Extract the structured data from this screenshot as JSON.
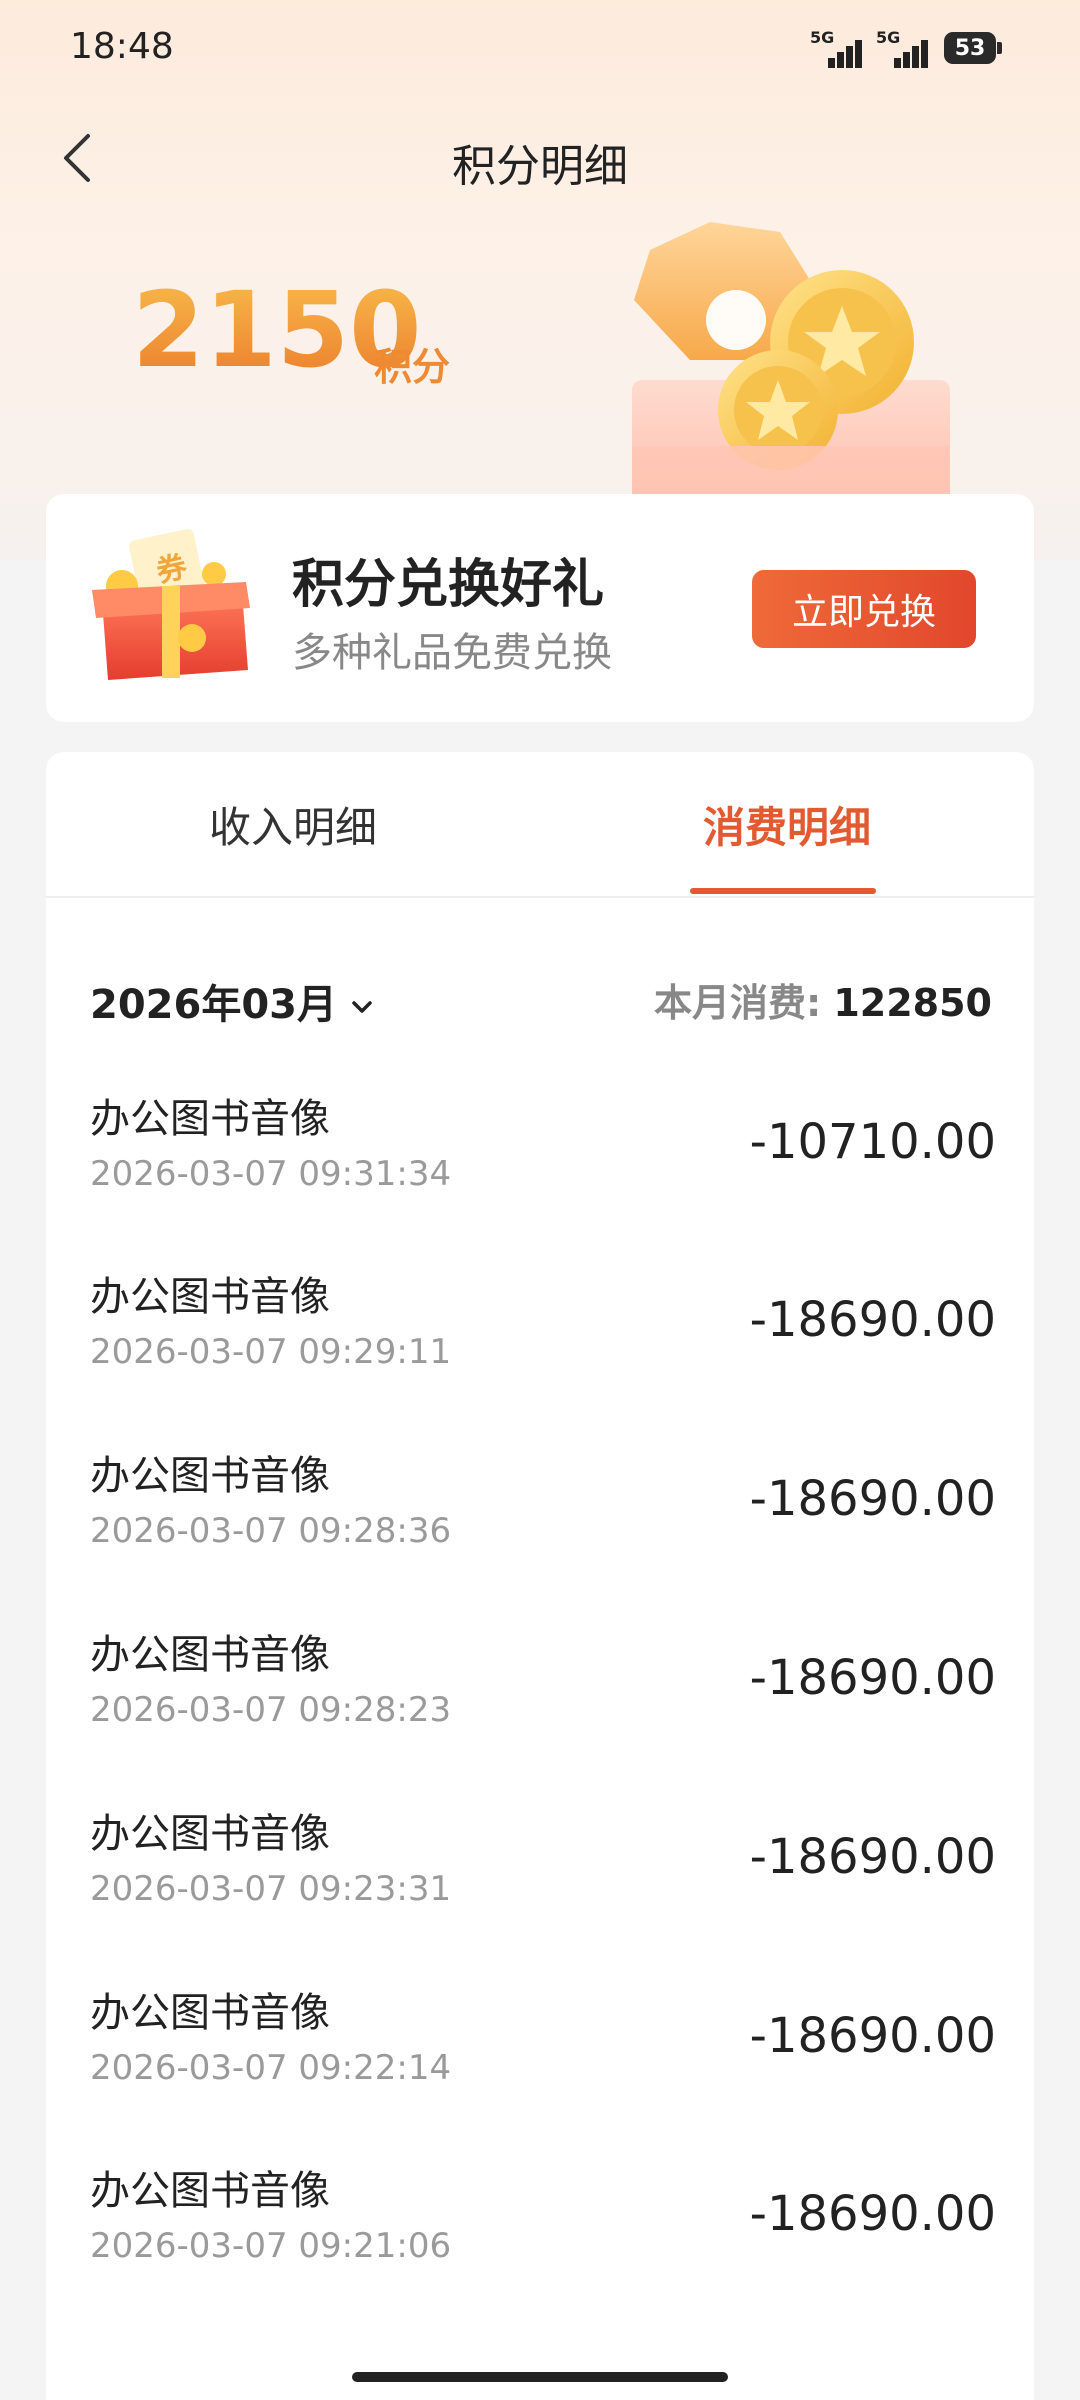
{
  "status_bar": {
    "time": "18:48",
    "signal_1_label": "5G",
    "signal_2_label": "5G",
    "battery_level": "53"
  },
  "header": {
    "title": "积分明细",
    "back_icon": "chevron-left-icon"
  },
  "points": {
    "value": "2150",
    "unit": "积分"
  },
  "exchange": {
    "title": "积分兑换好礼",
    "subtitle": "多种礼品免费兑换",
    "button_label": "立即兑换",
    "gift_label": "券"
  },
  "tabs": [
    {
      "label": "收入明细",
      "active": false
    },
    {
      "label": "消费明细",
      "active": true
    }
  ],
  "filter": {
    "month": "2026年03月",
    "summary_label": "本月消费:",
    "summary_value": "122850"
  },
  "records": [
    {
      "title": "办公图书音像",
      "time": "2026-03-07 09:31:34",
      "amount": "-10710.00"
    },
    {
      "title": "办公图书音像",
      "time": "2026-03-07 09:29:11",
      "amount": "-18690.00"
    },
    {
      "title": "办公图书音像",
      "time": "2026-03-07 09:28:36",
      "amount": "-18690.00"
    },
    {
      "title": "办公图书音像",
      "time": "2026-03-07 09:28:23",
      "amount": "-18690.00"
    },
    {
      "title": "办公图书音像",
      "time": "2026-03-07 09:23:31",
      "amount": "-18690.00"
    },
    {
      "title": "办公图书音像",
      "time": "2026-03-07 09:22:14",
      "amount": "-18690.00"
    },
    {
      "title": "办公图书音像",
      "time": "2026-03-07 09:21:06",
      "amount": "-18690.00"
    }
  ],
  "colors": {
    "accent": "#e35a30",
    "points_gold": "#ee8a33",
    "button": "#e95530"
  }
}
